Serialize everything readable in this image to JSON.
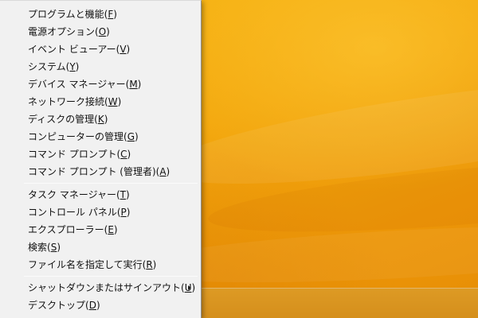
{
  "desktop": {
    "accent": "#f2a60a",
    "taskbar_color": "#d89320"
  },
  "menu": {
    "groups": [
      [
        {
          "label": "プログラムと機能(",
          "key": "F",
          "close": ")"
        },
        {
          "label": "電源オプション(",
          "key": "O",
          "close": ")"
        },
        {
          "label": "イベント ビューアー(",
          "key": "V",
          "close": ")"
        },
        {
          "label": "システム(",
          "key": "Y",
          "close": ")"
        },
        {
          "label": "デバイス マネージャー(",
          "key": "M",
          "close": ")"
        },
        {
          "label": "ネットワーク接続(",
          "key": "W",
          "close": ")"
        },
        {
          "label": "ディスクの管理(",
          "key": "K",
          "close": ")"
        },
        {
          "label": "コンピューターの管理(",
          "key": "G",
          "close": ")"
        },
        {
          "label": "コマンド プロンプト(",
          "key": "C",
          "close": ")"
        },
        {
          "label": "コマンド プロンプト (管理者)(",
          "key": "A",
          "close": ")"
        }
      ],
      [
        {
          "label": "タスク マネージャー(",
          "key": "T",
          "close": ")"
        },
        {
          "label": "コントロール パネル(",
          "key": "P",
          "close": ")"
        },
        {
          "label": "エクスプローラー(",
          "key": "E",
          "close": ")"
        },
        {
          "label": "検索(",
          "key": "S",
          "close": ")"
        },
        {
          "label": "ファイル名を指定して実行(",
          "key": "R",
          "close": ")"
        }
      ],
      [
        {
          "label": "シャットダウンまたはサインアウト(",
          "key": "U",
          "close": ")",
          "submenu": true,
          "arrow_icon": "chevron-right-icon"
        },
        {
          "label": "デスクトップ(",
          "key": "D",
          "close": ")"
        }
      ]
    ]
  }
}
